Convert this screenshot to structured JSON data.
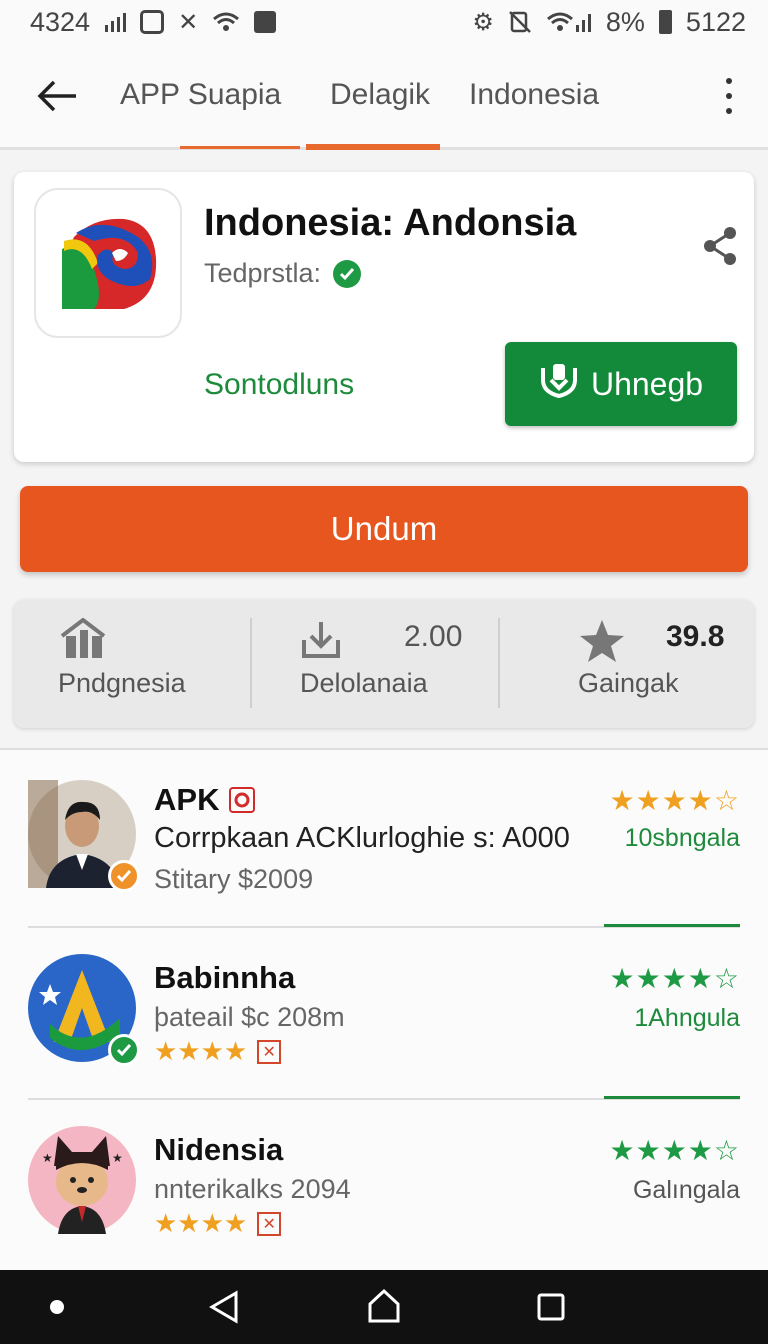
{
  "status_bar": {
    "left_text": "4324",
    "battery_text": "8%",
    "time_text": "5122"
  },
  "app_bar": {
    "tabs": [
      "APP Suapia",
      "Delagik",
      "Indonesia"
    ]
  },
  "app_card": {
    "title": "Indonesia: Andonsia",
    "developer": "Tedprstla:",
    "green_label": "Sontodluns",
    "primary_button": "Uhnegb"
  },
  "orange_button": "Undum",
  "stats": [
    {
      "label": "Pndgnesia",
      "value": "",
      "icon": "house-icon"
    },
    {
      "label": "Delolanaia",
      "value": "2.00",
      "icon": "download-icon"
    },
    {
      "label": "Gaingak",
      "value": "39.8",
      "icon": "star-icon"
    }
  ],
  "list": {
    "items": [
      {
        "name": "APK",
        "description": "Corrpkaan ACKlurloghie s: A000",
        "sub": "Stitary $2009",
        "stars": "★★★★☆",
        "rating_label": "10sbngala",
        "rating_label_color": "#1e8a3c"
      },
      {
        "name": "Babinnha",
        "sub": "þateail $c 208m",
        "mini_stars": "★★★★",
        "stars": "★★★★☆",
        "rating_label": "1Ahngula",
        "rating_label_color": "#1e8a3c"
      },
      {
        "name": "Nidensia",
        "sub": "nnterikalks 2094",
        "mini_stars": "★★★★",
        "stars": "★★★★☆",
        "rating_label": "Galıngala",
        "rating_label_color": "#555555"
      }
    ]
  },
  "colors": {
    "accent_orange": "#e8561f",
    "accent_green": "#138a3a",
    "star_gold": "#f0a020",
    "star_green": "#1e9a44"
  }
}
